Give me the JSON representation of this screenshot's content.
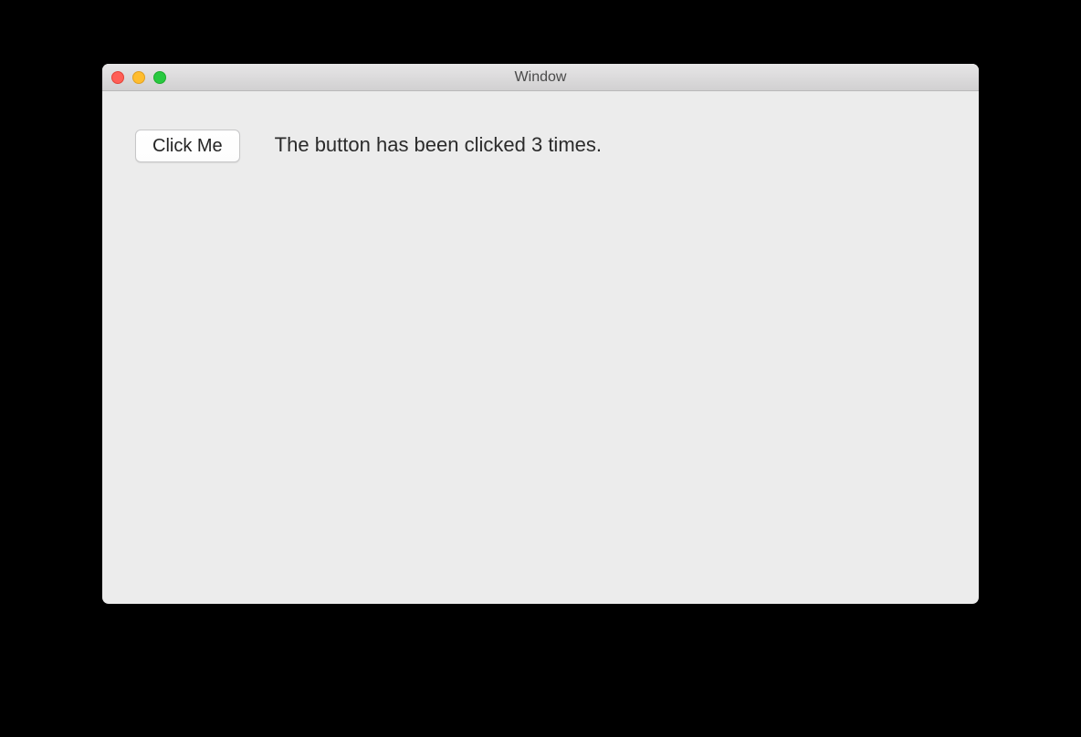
{
  "window": {
    "title": "Window"
  },
  "content": {
    "button_label": "Click Me",
    "status_text": "The button has been clicked 3 times."
  }
}
